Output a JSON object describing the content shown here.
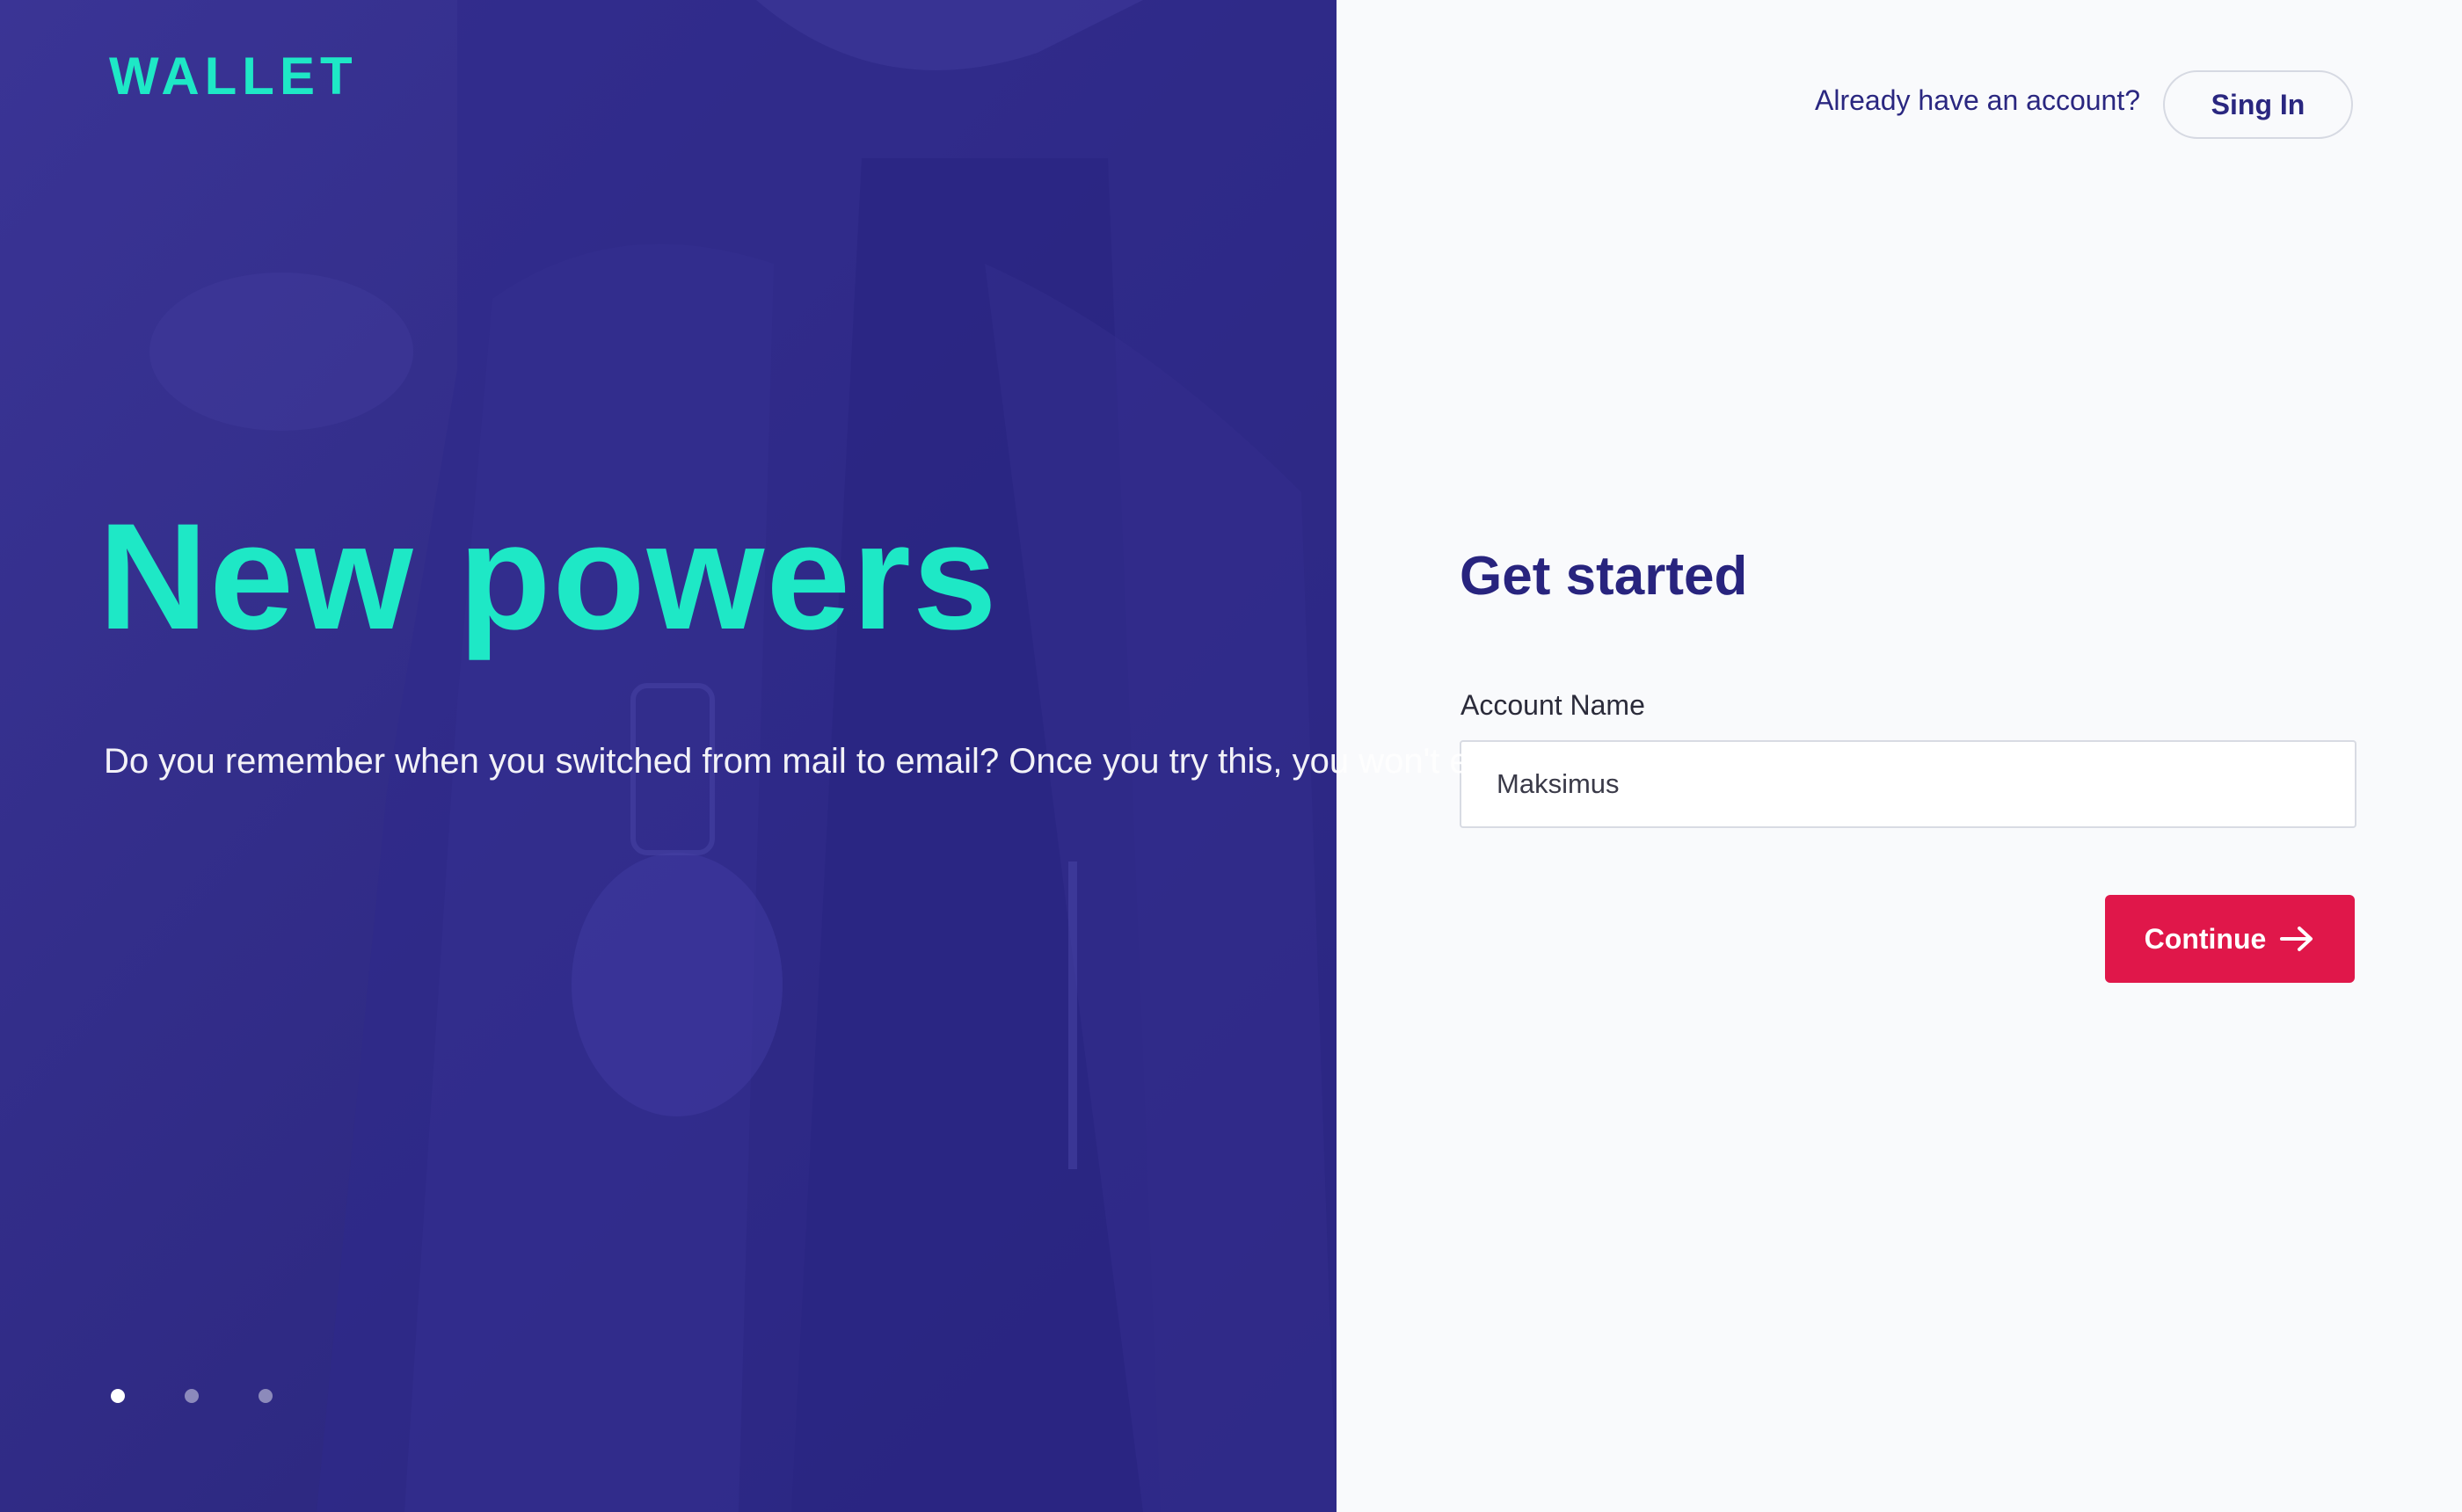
{
  "hero": {
    "logo": "WALLET",
    "headline": "New powers",
    "description": "Do you remember when you switched from mail to email? Once you try this, you won't ever want to use your old bank account again.",
    "slides": [
      {
        "active": true
      },
      {
        "active": false
      },
      {
        "active": false
      }
    ]
  },
  "header": {
    "prompt": "Already have an account?",
    "signin_label": "Sing In"
  },
  "form": {
    "title": "Get started",
    "account_name_label": "Account Name",
    "account_name_value": "Maksimus",
    "continue_label": "Continue",
    "continue_icon": "arrow-right-icon"
  },
  "colors": {
    "hero_bg": "#2d2785",
    "accent": "#1ee8c6",
    "primary_text": "#28247e",
    "cta": "#e0174a",
    "panel_bg": "#f9fafc"
  }
}
